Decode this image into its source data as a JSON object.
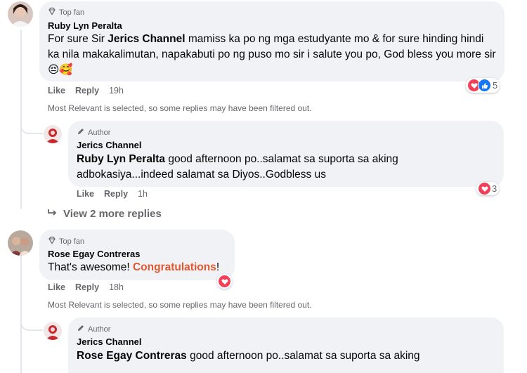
{
  "comment1": {
    "badge": "Top fan",
    "author": "Ruby Lyn Peralta",
    "text_pre": "For sure Sir ",
    "text_tag": "Jerics Channel",
    "text_post": " mamiss ka po ng mga estudyante mo & for sure hinding hindi ka nila makakalimutan, napakabuti po ng puso mo sir i salute you po, God bless you more sir",
    "emojis": "😔🥰",
    "like": "Like",
    "reply": "Reply",
    "time": "19h",
    "reactions_count": "5",
    "notice": "Most Relevant is selected, so some replies may have been filtered out."
  },
  "reply1": {
    "badge": "Author",
    "author": "Jerics Channel",
    "text_tag": "Ruby Lyn Peralta",
    "text_post": " good afternoon po..salamat sa suporta sa aking adbokasiya...indeed salamat sa Diyos..Godbless us",
    "like": "Like",
    "reply": "Reply",
    "time": "1h",
    "reactions_count": "3"
  },
  "view_more": "View 2 more replies",
  "comment2": {
    "badge": "Top fan",
    "author": "Rose Egay Contreras",
    "text_pre": "That's awesome! ",
    "text_highlight": "Congratulations",
    "text_post": "!",
    "like": "Like",
    "reply": "Reply",
    "time": "18h",
    "notice": "Most Relevant is selected, so some replies may have been filtered out."
  },
  "reply2": {
    "badge": "Author",
    "author": "Jerics Channel",
    "text_tag": "Rose Egay Contreras",
    "text_post": " good afternoon po..salamat sa suporta sa aking"
  },
  "colors": {
    "bubble": "#f0f2f5",
    "meta": "#65676b",
    "highlight": "#e4572e",
    "heart": "#f33e58",
    "like": "#1877f2"
  }
}
